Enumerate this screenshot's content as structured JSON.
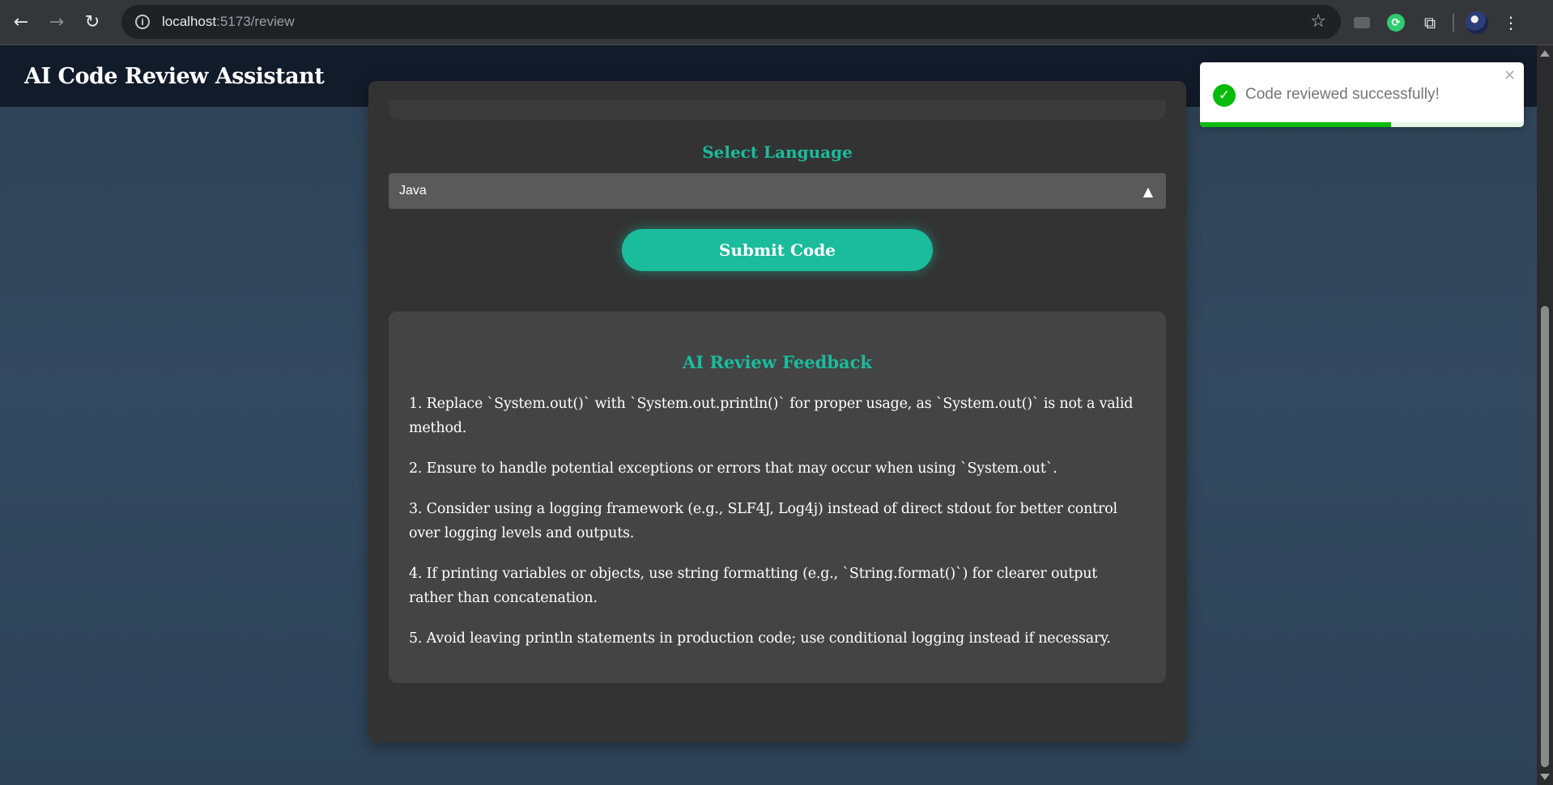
{
  "browser": {
    "url_host": "localhost",
    "url_path": ":5173/review",
    "icons": {
      "back": "arrow-left-icon",
      "forward": "arrow-right-icon",
      "reload": "reload-icon",
      "site_info": "info-icon",
      "bookmark": "star-icon",
      "extensions": "puzzle-icon",
      "menu": "kebab-menu-icon"
    }
  },
  "header": {
    "title": "AI Code Review Assistant"
  },
  "form": {
    "language_label": "Select Language",
    "language_value": "Java",
    "submit_label": "Submit Code"
  },
  "feedback": {
    "title": "AI Review Feedback",
    "items": [
      "1. Replace `System.out()` with `System.out.println()` for proper usage, as `System.out()` is not a valid method.",
      "2. Ensure to handle potential exceptions or errors that may occur when using `System.out`.",
      "3. Consider using a logging framework (e.g., SLF4J, Log4j) instead of direct stdout for better control over logging levels and outputs.",
      "4. If printing variables or objects, use string formatting (e.g., `String.format()`) for clearer output rather than concatenation.",
      "5. Avoid leaving println statements in production code; use conditional logging instead if necessary."
    ]
  },
  "toast": {
    "message": "Code reviewed successfully!",
    "progress": 0.59,
    "status_color": "#07bc0c"
  },
  "colors": {
    "accent": "#1abc9c",
    "header_bg": "#121b2a",
    "card_bg": "#333333",
    "panel_bg": "#444444"
  }
}
